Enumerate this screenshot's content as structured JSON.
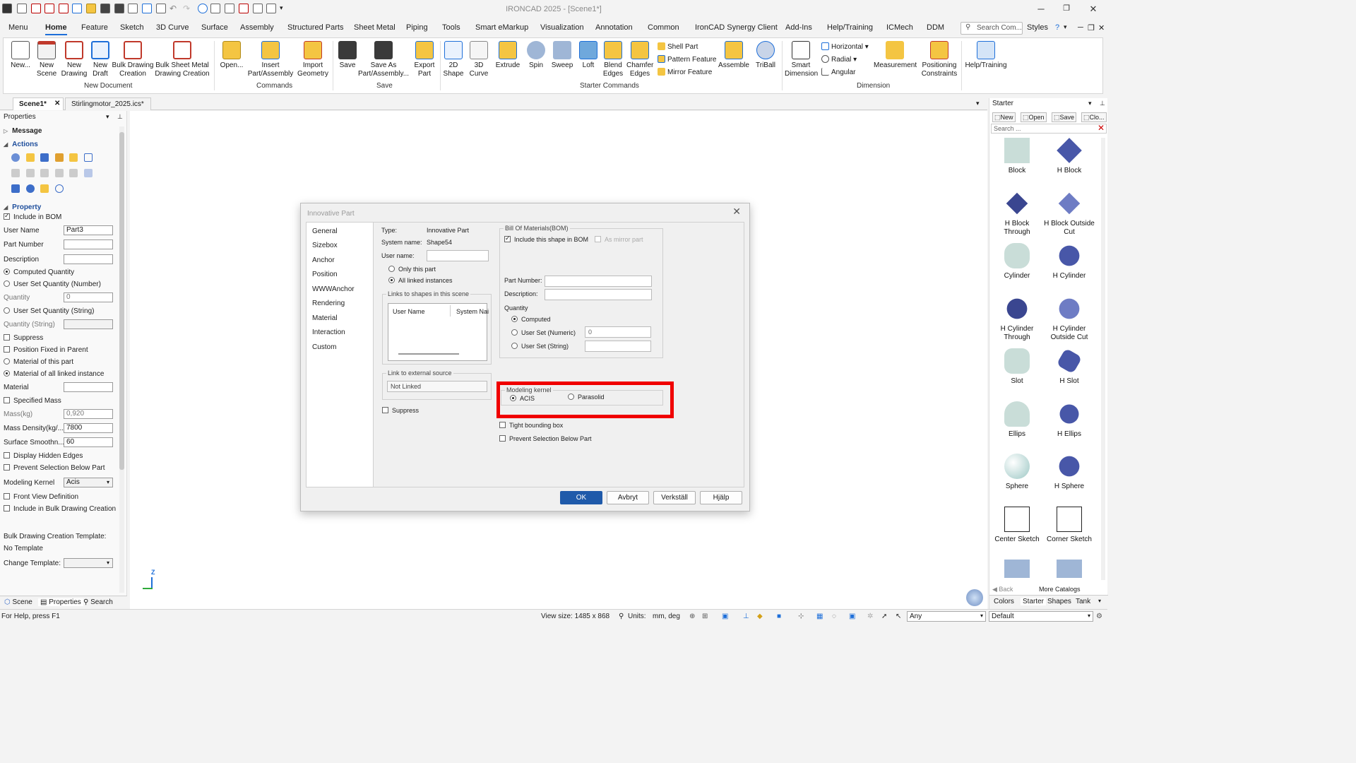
{
  "app": {
    "title": "IRONCAD 2025 - [Scene1*]"
  },
  "ribbon_tabs": [
    "Menu",
    "Home",
    "Feature",
    "Sketch",
    "3D Curve",
    "Surface",
    "Assembly",
    "Structured Parts",
    "Sheet Metal",
    "Piping",
    "Tools",
    "Smart eMarkup",
    "Visualization",
    "Annotation",
    "Common",
    "IronCAD Synergy Client",
    "Add-Ins",
    "Help/Training",
    "ICMech",
    "DDM"
  ],
  "ribbon_right": {
    "search_placeholder": "Search Com...",
    "styles": "Styles"
  },
  "ribbon": {
    "new_document": {
      "label": "New Document",
      "buttons": [
        "New...",
        "New Scene",
        "New Drawing",
        "New Draft",
        "Bulk Drawing Creation",
        "Bulk Sheet Metal Drawing Creation"
      ]
    },
    "commands": {
      "label": "Commands",
      "buttons": [
        "Open...",
        "Insert Part/Assembly",
        "Import Geometry"
      ]
    },
    "save": {
      "label": "Save",
      "buttons": [
        "Save",
        "Save As Part/Assembly...",
        "Export Part"
      ]
    },
    "starter_commands": {
      "label": "Starter Commands",
      "buttons": [
        "2D Shape",
        "3D Curve",
        "Extrude",
        "Spin",
        "Sweep",
        "Loft",
        "Blend Edges",
        "Chamfer Edges"
      ],
      "small": [
        "Shell Part",
        "Pattern Feature",
        "Mirror Feature"
      ],
      "more": [
        "Assemble",
        "TriBall"
      ]
    },
    "dimension": {
      "label": "Dimension",
      "buttons": [
        "Smart Dimension"
      ],
      "small": [
        "Horizontal",
        "Radial",
        "Angular"
      ],
      "more": [
        "Measurement",
        "Positioning Constraints"
      ]
    },
    "help": {
      "buttons": [
        "Help/Training"
      ]
    }
  },
  "doc_tabs": [
    "Scene1*",
    "Stirlingmotor_2025.ics*"
  ],
  "properties_panel": {
    "title": "Properties",
    "message": "Message",
    "actions": "Actions",
    "property": "Property",
    "include_bom": "Include in BOM",
    "user_name": {
      "label": "User Name",
      "value": "Part3"
    },
    "part_number": {
      "label": "Part Number",
      "value": ""
    },
    "description": {
      "label": "Description",
      "value": ""
    },
    "computed_qty": "Computed Quantity",
    "user_set_qty_num": "User Set Quantity (Number)",
    "quantity": {
      "label": "Quantity",
      "value": "0"
    },
    "user_set_qty_str": "User Set Quantity (String)",
    "quantity_str": {
      "label": "Quantity (String)",
      "value": ""
    },
    "suppress": "Suppress",
    "position_fixed": "Position Fixed in Parent",
    "material_of_part": "Material of this part",
    "material_all_linked": "Material of all linked instance",
    "material": {
      "label": "Material",
      "value": ""
    },
    "specified_mass": "Specified Mass",
    "mass": {
      "label": "Mass(kg)",
      "value": "0,920"
    },
    "mass_density": {
      "label": "Mass Density(kg/...",
      "value": "7800"
    },
    "surface_smooth": {
      "label": "Surface Smoothn...",
      "value": "60"
    },
    "display_hidden_edges": "Display Hidden Edges",
    "prevent_selection": "Prevent Selection Below Part",
    "modeling_kernel": {
      "label": "Modeling Kernel",
      "value": "Acis"
    },
    "front_view": "Front View Definition",
    "include_bulk": "Include in Bulk Drawing Creation",
    "bulk_template_label": "Bulk Drawing Creation Template:",
    "no_template": "No Template",
    "change_template": "Change Template:",
    "bottom_tabs": [
      "Scene",
      "Properties",
      "Search"
    ]
  },
  "dialog": {
    "title": "Innovative Part",
    "nav": [
      "General",
      "Sizebox",
      "Anchor",
      "Position",
      "WWWAnchor",
      "Rendering",
      "Material",
      "Interaction",
      "Custom"
    ],
    "type_label": "Type:",
    "type_value": "Innovative Part",
    "system_name_label": "System name:",
    "system_name_value": "Shape54",
    "user_name_label": "User name:",
    "only_this_part": "Only this part",
    "all_linked": "All linked instances",
    "links_group": "Links to shapes in this scene",
    "links_col1": "User Name",
    "links_col2": "System Nai",
    "external_group": "Link to external source",
    "not_linked": "Not Linked",
    "suppress": "Suppress",
    "bom_group": "Bill Of Materials(BOM)",
    "include_bom": "Include this shape in BOM",
    "as_mirror": "As mirror part",
    "part_number": "Part Number:",
    "description": "Description:",
    "quantity": "Quantity",
    "computed": "Computed",
    "user_set_numeric": "User Set (Numeric)",
    "numeric_value": "0",
    "user_set_string": "User Set (String)",
    "kernel_group": "Modeling kernel",
    "acis": "ACIS",
    "parasolid": "Parasolid",
    "tight_bbox": "Tight bounding box",
    "prevent_selection": "Prevent Selection Below Part",
    "buttons": [
      "OK",
      "Avbryt",
      "Verkställ",
      "Hjälp"
    ]
  },
  "catalog": {
    "title": "Starter",
    "buttons": [
      "New",
      "Open",
      "Save",
      "Clo..."
    ],
    "search_placeholder": "Search ...",
    "items": [
      "Block",
      "H Block",
      "H Block Through",
      "H Block Outside Cut",
      "Cylinder",
      "H Cylinder",
      "H Cylinder Through",
      "H Cylinder Outside Cut",
      "Slot",
      "H Slot",
      "Ellips",
      "H Ellips",
      "Sphere",
      "H Sphere",
      "Center Sketch",
      "Corner Sketch"
    ],
    "back": "Back",
    "more": "More Catalogs",
    "bottom_tabs": [
      "Colors",
      "Starter",
      "Shapes",
      "Tank"
    ]
  },
  "status": {
    "help": "For Help, press F1",
    "view_size": "View size: 1485 x 868",
    "units_label": "Units:",
    "units_value": "mm, deg",
    "filter": "Any",
    "style": "Default"
  },
  "colors": {
    "accent": "#1f5aaa",
    "highlight": "#f00000"
  }
}
